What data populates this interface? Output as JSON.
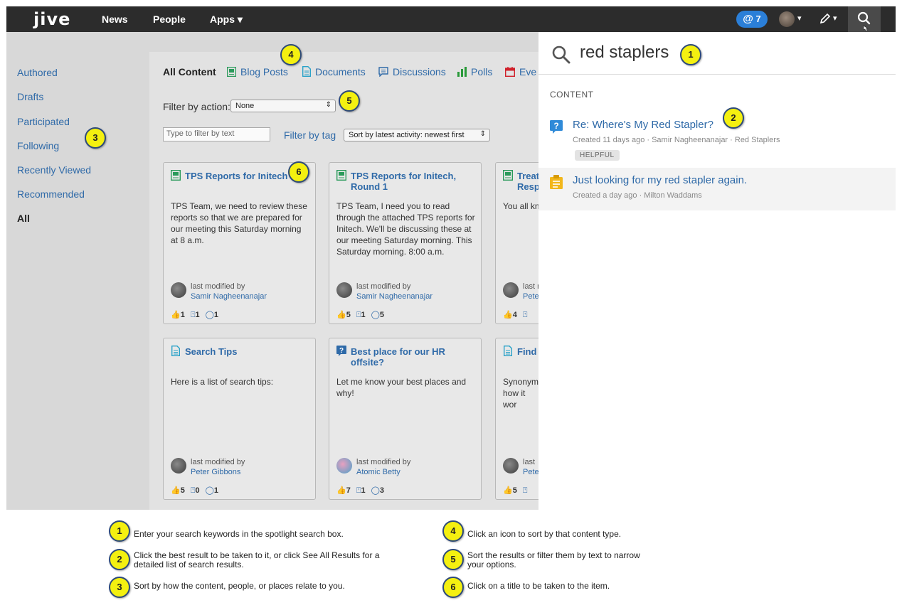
{
  "nav": {
    "logo": "jive",
    "news": "News",
    "people": "People",
    "apps": "Apps ▾",
    "mentions_count": "7",
    "at_symbol": "@",
    "caret": "▾"
  },
  "sidebar": {
    "items": [
      {
        "label": "Authored"
      },
      {
        "label": "Drafts"
      },
      {
        "label": "Participated"
      },
      {
        "label": "Following"
      },
      {
        "label": "Recently Viewed"
      },
      {
        "label": "Recommended"
      },
      {
        "label": "All"
      }
    ]
  },
  "tabs": [
    {
      "label": "All Content"
    },
    {
      "label": "Blog Posts",
      "icon": "blog-icon",
      "color": "#2a9a5a"
    },
    {
      "label": "Documents",
      "icon": "document-icon",
      "color": "#2aa2c8"
    },
    {
      "label": "Discussions",
      "icon": "discussion-icon",
      "color": "#2f6aa8"
    },
    {
      "label": "Polls",
      "icon": "poll-icon",
      "color": "#2a9a3a"
    },
    {
      "label": "Eve",
      "icon": "event-icon",
      "color": "#d0202a"
    }
  ],
  "filters": {
    "action_label": "Filter by action:",
    "action_value": "None",
    "text_placeholder": "Type to filter by text",
    "tag_label": "Filter by tag",
    "sort_value": "Sort by latest activity: newest first"
  },
  "cards": [
    {
      "title": "TPS Reports for Initech",
      "icon": "blog-icon",
      "body": "TPS Team, we need to review these reports so that we are prepared for our meeting this Saturday morning at 8 a.m.",
      "modified_label": "last modified by",
      "author": "Samir Nagheenanajar",
      "likes": "1",
      "bookmarks": "1",
      "comments": "1"
    },
    {
      "title": "TPS Reports for Initech, Round 1",
      "icon": "blog-icon",
      "body": "TPS Team, I need you to read through the attached TPS reports for Initech. We'll be discussing these at our meeting Saturday morning. This Saturday morning. 8:00 a.m.",
      "modified_label": "last modified by",
      "author": "Samir Nagheenanajar",
      "likes": "5",
      "bookmarks": "1",
      "comments": "5"
    },
    {
      "title": "Treati Resp",
      "icon": "blog-icon",
      "body": "You all kno",
      "modified_label": "last r",
      "author": "Peter",
      "likes": "4",
      "bookmarks": "",
      "comments": ""
    },
    {
      "title": "Search Tips",
      "icon": "document-icon",
      "body": "Here is a list of search tips:",
      "modified_label": "last modified by",
      "author": "Peter Gibbons",
      "likes": "5",
      "bookmarks": "0",
      "comments": "1"
    },
    {
      "title": "Best place for our HR offsite?",
      "icon": "question-icon",
      "body": "Let me know your best places and why!",
      "modified_label": "last modified by",
      "author": "Atomic Betty",
      "likes": "7",
      "bookmarks": "1",
      "comments": "3"
    },
    {
      "title": "Find T",
      "icon": "document-icon",
      "body": "Synonym how it wor",
      "modified_label": "last",
      "author": "Peter",
      "likes": "5",
      "bookmarks": "",
      "comments": ""
    }
  ],
  "spotlight": {
    "query": "red staplers",
    "section_header": "CONTENT",
    "results": [
      {
        "title": "Re: Where's My Red Stapler?",
        "meta": "Created 11 days ago · Samir Nagheenanajar · Red Staplers",
        "badge": "HELPFUL",
        "icon": "question-icon"
      },
      {
        "title": "Just looking for my red stapler again.",
        "meta": "Created a day ago · Milton Waddams",
        "icon": "idea-icon"
      }
    ]
  },
  "callouts": [
    "1",
    "2",
    "3",
    "4",
    "5",
    "6"
  ],
  "legend": [
    {
      "num": "1",
      "text": "Enter your search keywords in the spotlight search box."
    },
    {
      "num": "2",
      "text": "Click the best result to be taken to it, or click See All Results for a detailed list of search results."
    },
    {
      "num": "3",
      "text": "Sort by how the content, people, or places relate to you."
    },
    {
      "num": "4",
      "text": "Click an icon to sort by that content type."
    },
    {
      "num": "5",
      "text": "Sort the results or filter them by text to narrow your options."
    },
    {
      "num": "6",
      "text": "Click on a title to be taken to the item."
    }
  ]
}
